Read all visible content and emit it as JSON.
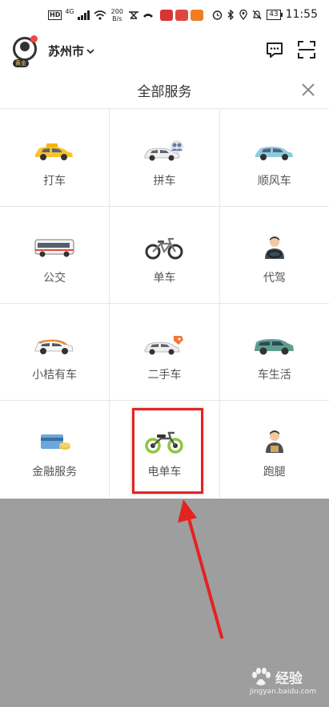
{
  "status_bar": {
    "hd": "HD",
    "network": "4G",
    "speed_value": "200",
    "speed_unit": "B/s",
    "battery": "43",
    "time": "11:55"
  },
  "header": {
    "avatar_badge": "黄金",
    "city": "苏州市"
  },
  "panel": {
    "title": "全部服务"
  },
  "services": [
    {
      "label": "打车",
      "icon": "taxi-car-icon"
    },
    {
      "label": "拼车",
      "icon": "carpool-icon"
    },
    {
      "label": "顺风车",
      "icon": "hitch-car-icon"
    },
    {
      "label": "公交",
      "icon": "bus-icon"
    },
    {
      "label": "单车",
      "icon": "bicycle-icon"
    },
    {
      "label": "代驾",
      "icon": "chauffeur-icon"
    },
    {
      "label": "小桔有车",
      "icon": "rental-car-icon"
    },
    {
      "label": "二手车",
      "icon": "used-car-icon"
    },
    {
      "label": "车生活",
      "icon": "suv-icon"
    },
    {
      "label": "金融服务",
      "icon": "finance-card-icon"
    },
    {
      "label": "电单车",
      "icon": "ebike-icon"
    },
    {
      "label": "跑腿",
      "icon": "courier-icon"
    }
  ],
  "watermark": {
    "brand": "经验",
    "url": "jingyan.baidu.com"
  },
  "colors": {
    "highlight": "#e52222",
    "overlay": "#9e9e9e",
    "ebike_green": "#8cc63f"
  }
}
